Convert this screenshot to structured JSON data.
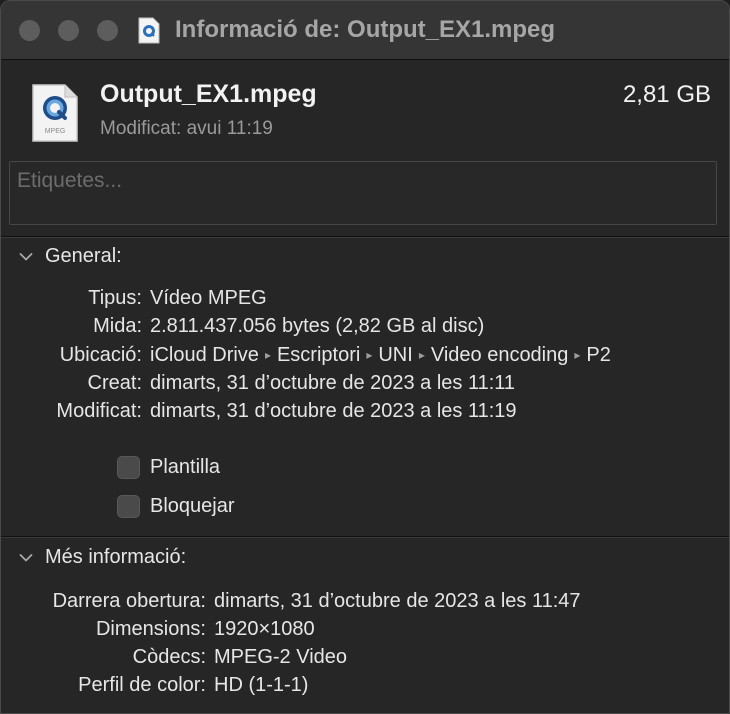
{
  "window": {
    "title": "Informació de: Output_EX1.mpeg"
  },
  "header": {
    "filename": "Output_EX1.mpeg",
    "size": "2,81 GB",
    "modified": "Modificat: avui 11:19",
    "tags_placeholder": "Etiquetes...",
    "icon_label": "MPEG"
  },
  "general": {
    "title": "General:",
    "rows": [
      {
        "label": "Tipus:",
        "value": "Vídeo MPEG"
      },
      {
        "label": "Mida:",
        "value": "2.811.437.056 bytes (2,82 GB al disc)"
      },
      {
        "label": "Ubicació:",
        "path": [
          "iCloud Drive",
          "Escriptori",
          "UNI",
          "Video encoding",
          "P2"
        ]
      },
      {
        "label": "Creat:",
        "value": "dimarts, 31 d’octubre de 2023 a les 11:11"
      },
      {
        "label": "Modificat:",
        "value": "dimarts, 31 d’octubre de 2023 a les 11:19"
      }
    ],
    "path_separator": "▸",
    "checkboxes": [
      {
        "label": "Plantilla",
        "checked": false
      },
      {
        "label": "Bloquejar",
        "checked": false
      }
    ]
  },
  "more_info": {
    "title": "Més informació:",
    "rows": [
      {
        "label": "Darrera obertura:",
        "value": "dimarts, 31 d’octubre de 2023 a les 11:47"
      },
      {
        "label": "Dimensions:",
        "value": "1920×1080"
      },
      {
        "label": "Còdecs:",
        "value": "MPEG-2 Video"
      },
      {
        "label": "Perfil de color:",
        "value": "HD (1-1-1)"
      }
    ]
  }
}
